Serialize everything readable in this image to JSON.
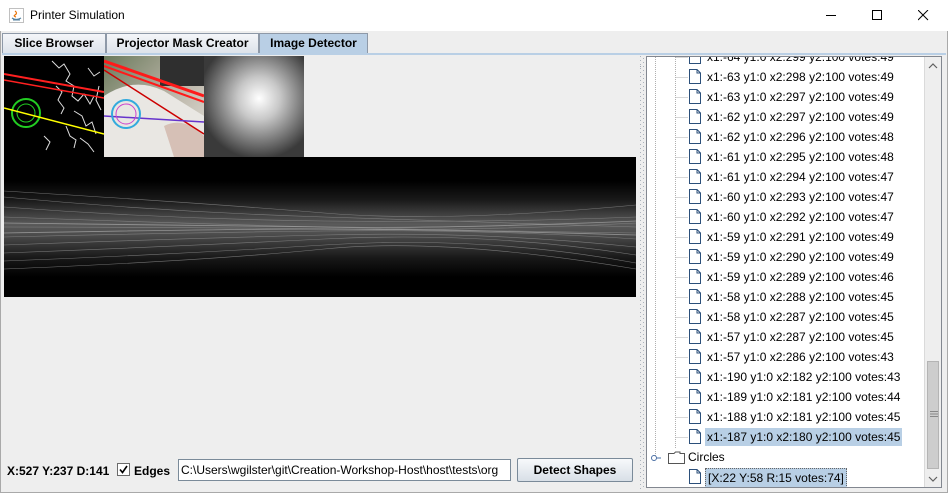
{
  "window": {
    "title": "Printer Simulation",
    "controls": [
      "minimize",
      "maximize",
      "close"
    ]
  },
  "tabs": [
    {
      "label": "Slice Browser",
      "active": false
    },
    {
      "label": "Projector Mask Creator",
      "active": false
    },
    {
      "label": "Image Detector",
      "active": true
    }
  ],
  "detector": {
    "status": "X:527 Y:237 D:141",
    "edges_label": "Edges",
    "edges_checked": true,
    "path_value": "C:\\Users\\wgilster\\git\\Creation-Workshop-Host\\host\\tests\\org",
    "detect_button": "Detect Shapes"
  },
  "tree": {
    "lines": [
      "x1:-64 y1:0 x2:299 y2:100 votes:49",
      "x1:-63 y1:0 x2:298 y2:100 votes:49",
      "x1:-63 y1:0 x2:297 y2:100 votes:49",
      "x1:-62 y1:0 x2:297 y2:100 votes:49",
      "x1:-62 y1:0 x2:296 y2:100 votes:48",
      "x1:-61 y1:0 x2:295 y2:100 votes:48",
      "x1:-61 y1:0 x2:294 y2:100 votes:47",
      "x1:-60 y1:0 x2:293 y2:100 votes:47",
      "x1:-60 y1:0 x2:292 y2:100 votes:47",
      "x1:-59 y1:0 x2:291 y2:100 votes:49",
      "x1:-59 y1:0 x2:290 y2:100 votes:49",
      "x1:-59 y1:0 x2:289 y2:100 votes:46",
      "x1:-58 y1:0 x2:288 y2:100 votes:45",
      "x1:-58 y1:0 x2:287 y2:100 votes:45",
      "x1:-57 y1:0 x2:287 y2:100 votes:45",
      "x1:-57 y1:0 x2:286 y2:100 votes:43",
      "x1:-190 y1:0 x2:182 y2:100 votes:43",
      "x1:-189 y1:0 x2:181 y2:100 votes:44",
      "x1:-188 y1:0 x2:181 y2:100 votes:45",
      "x1:-187 y1:0 x2:180 y2:100 votes:45"
    ],
    "selected_line": "x1:-187 y1:0 x2:180 y2:100 votes:45",
    "circles_folder": "Circles",
    "circle_item": "[X:22 Y:58 R:15 votes:74]"
  },
  "colors": {
    "tab_active": "#b9cfe5",
    "selection": "#b8cfe5",
    "panel_bg": "#eeeeee"
  }
}
